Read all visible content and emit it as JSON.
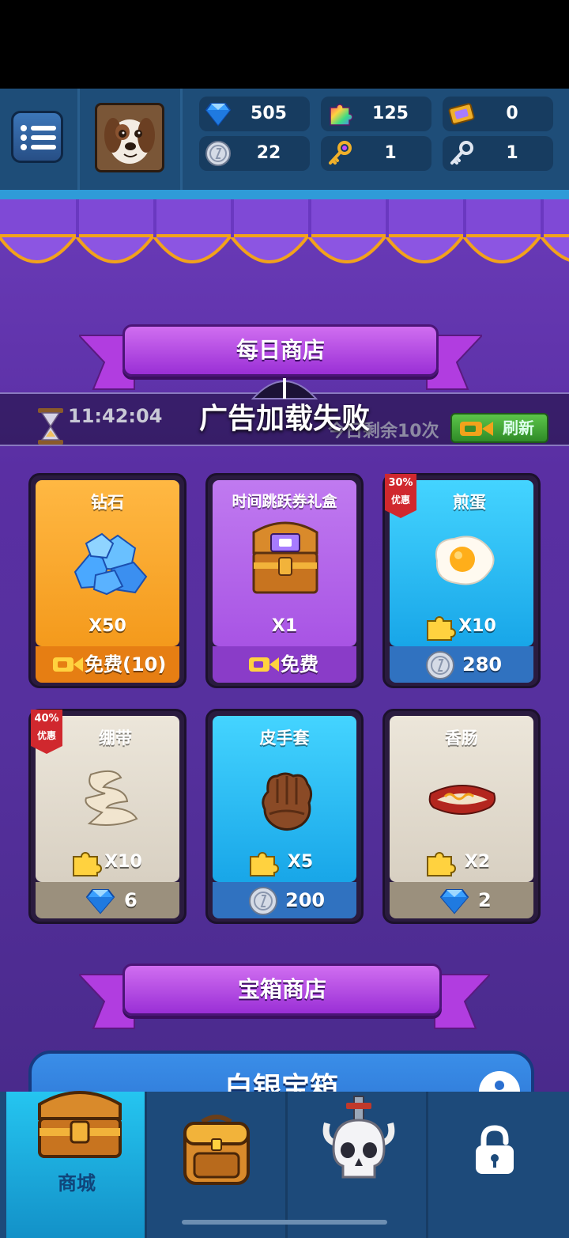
{
  "resources": {
    "diamonds": "505",
    "puzzle_pieces": "125",
    "time_tickets": "0",
    "silver_coins": "22",
    "gold_keys": "1",
    "silver_keys": "1"
  },
  "daily_shop": {
    "title": "每日商店",
    "timer": "11:42:04",
    "remaining": "今日剩余10次",
    "refresh_label": "刷新",
    "toast": "广告加载失败"
  },
  "items": [
    {
      "name": "钻石",
      "qty": "X50",
      "price": "免费(10)",
      "price_type": "ad"
    },
    {
      "name": "时间跳跃券礼盒",
      "qty": "X1",
      "price": "免费",
      "price_type": "ad"
    },
    {
      "name": "煎蛋",
      "qty": "X10",
      "price": "280",
      "price_type": "coin",
      "discount_pct": "30%",
      "discount_label": "优惠"
    },
    {
      "name": "绷带",
      "qty": "X10",
      "price": "6",
      "price_type": "diamond",
      "discount_pct": "40%",
      "discount_label": "优惠"
    },
    {
      "name": "皮手套",
      "qty": "X5",
      "price": "200",
      "price_type": "coin"
    },
    {
      "name": "香肠",
      "qty": "X2",
      "price": "2",
      "price_type": "diamond"
    }
  ],
  "chest_shop": {
    "title": "宝箱商店",
    "chest_title": "白银宝箱"
  },
  "nav": {
    "shop_label": "商城"
  },
  "colors": {
    "shop_background": "#5a2fa3",
    "banner": "#b44ee4",
    "top_bar": "#1e4d78",
    "nav_active": "#25c5f0"
  }
}
